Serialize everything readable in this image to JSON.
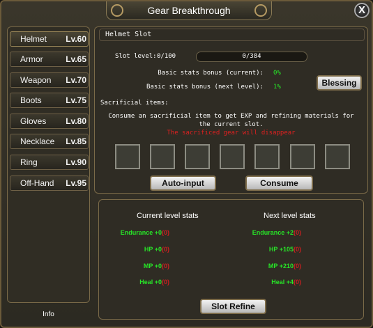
{
  "window": {
    "title": "Gear Breakthrough",
    "close_label": "X"
  },
  "sidebar": {
    "items": [
      {
        "name": "Helmet",
        "level": "Lv.60"
      },
      {
        "name": "Armor",
        "level": "Lv.65"
      },
      {
        "name": "Weapon",
        "level": "Lv.70"
      },
      {
        "name": "Boots",
        "level": "Lv.75"
      },
      {
        "name": "Gloves",
        "level": "Lv.80"
      },
      {
        "name": "Necklace",
        "level": "Lv.85"
      },
      {
        "name": "Ring",
        "level": "Lv.90"
      },
      {
        "name": "Off-Hand",
        "level": "Lv.95"
      }
    ],
    "info_label": "Info"
  },
  "slot_panel": {
    "header": "Helmet Slot",
    "slot_level_label": "Slot level:",
    "slot_level_value": "0/100",
    "progress_text": "0/384",
    "progress_fraction": 0,
    "bonus_current_label": "Basic stats bonus (current):",
    "bonus_current_value": "0%",
    "bonus_next_label": "Basic stats bonus (next level):",
    "bonus_next_value": "1%",
    "blessing_button": "Blessing",
    "sacrificial_label": "Sacrificial items:",
    "instruction_line1": "Consume an  sacrificial item to get EXP and refining materials for",
    "instruction_line2": "the current slot.",
    "warning": "The sacrificed gear will disappear",
    "slot_count": 7,
    "auto_input_button": "Auto-input",
    "consume_button": "Consume"
  },
  "stats_panel": {
    "current_header": "Current level stats",
    "next_header": "Next level stats",
    "current": [
      {
        "label": "Endurance",
        "value": "+0",
        "suffix": "(0)"
      },
      {
        "label": "HP",
        "value": "+0",
        "suffix": "(0)"
      },
      {
        "label": "MP",
        "value": "+0",
        "suffix": "(0)"
      },
      {
        "label": "Heal",
        "value": "+0",
        "suffix": "(0)"
      }
    ],
    "next": [
      {
        "label": "Endurance",
        "value": "+2",
        "suffix": "(0)"
      },
      {
        "label": "HP",
        "value": "+105",
        "suffix": "(0)"
      },
      {
        "label": "MP",
        "value": "+210",
        "suffix": "(0)"
      },
      {
        "label": "Heal",
        "value": "+4",
        "suffix": "(0)"
      }
    ],
    "refine_button": "Slot Refine"
  },
  "colors": {
    "green": "#27e527",
    "red": "#e02020",
    "gold_border": "#7a6a48"
  }
}
